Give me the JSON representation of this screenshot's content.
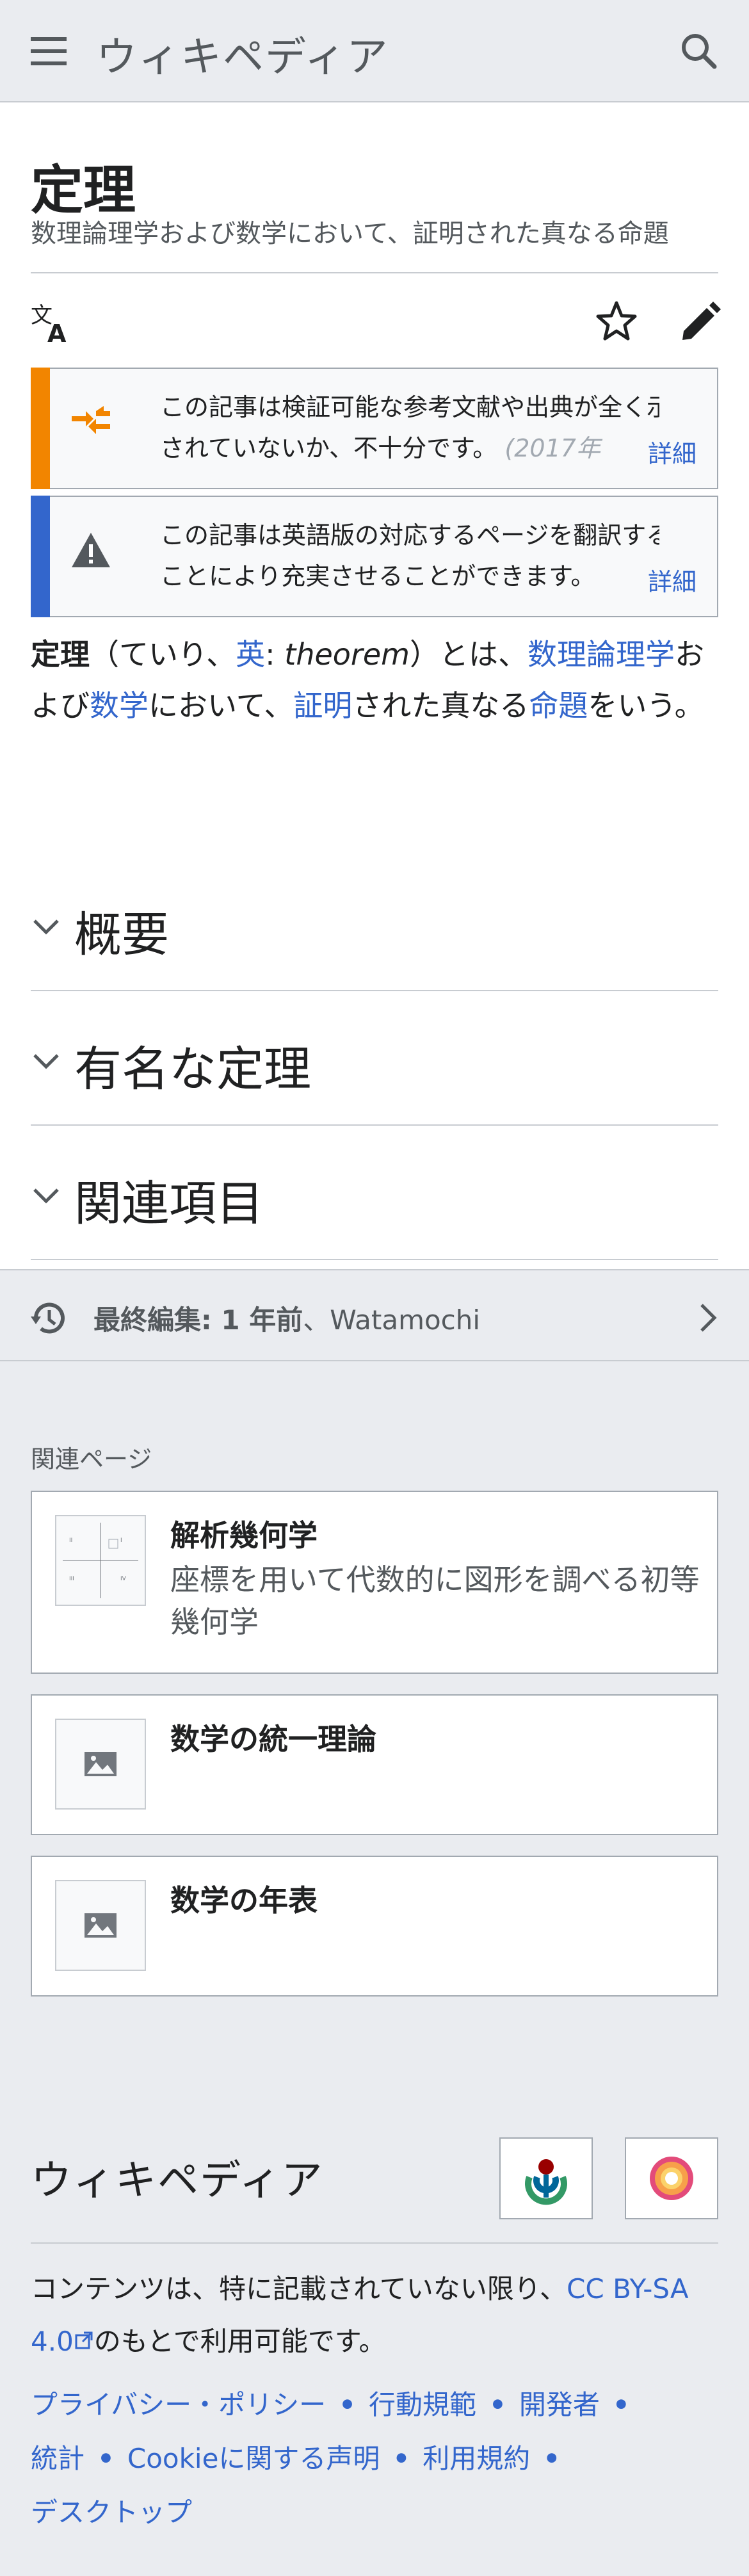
{
  "header": {
    "wordmark": "ウィキペディア"
  },
  "page": {
    "title": "定理",
    "tagline": "数理論理学および数学において、証明された真なる命題"
  },
  "notices": [
    {
      "text_line1": "この記事は検証可能な参考文献や出典が全く示",
      "text_line2": "されていないか、不十分です。",
      "text_fade": "(2017年",
      "detail": "詳細",
      "color": "#fc3"
    },
    {
      "text_line1": "この記事は英語版の対応するページを翻訳する",
      "text_line2": "ことにより充実させることができます。",
      "detail": "詳細",
      "color": "#36c"
    }
  ],
  "lead": {
    "term": "定理",
    "open": "（ていり、",
    "en": "英",
    "colon": ": ",
    "en_word": "theorem",
    "close": "）とは、",
    "link_math_logic": "数理論理学",
    "and": "および",
    "link_math": "数学",
    "in": "において、",
    "link_proof": "証明",
    "true": "された真なる",
    "link_prop": "命題",
    "end": "をいう。"
  },
  "sections": [
    "概要",
    "有名な定理",
    "関連項目"
  ],
  "last_edit": {
    "prefix": "最終編集: 1 年前",
    "sep": "、",
    "user": "Watamochi"
  },
  "related": {
    "title": "関連ページ",
    "cards": [
      {
        "title": "解析幾何学",
        "desc": "座標を用いて代数的に図形を調べる初等幾何学"
      },
      {
        "title": "数学の統一理論",
        "desc": ""
      },
      {
        "title": "数学の年表",
        "desc": ""
      }
    ]
  },
  "footer": {
    "wordmark": "ウィキペディア",
    "license_before": "コンテンツは、特に記載されていない限り、",
    "license_link": "CC BY-SA 4.0",
    "license_after": "のもとで利用可能です。",
    "links": [
      "プライバシー・ポリシー",
      "行動規範",
      "開発者",
      "統計",
      "Cookieに関する声明",
      "利用規約",
      "デスクトップ"
    ]
  },
  "colors": {
    "link": "#3366cc",
    "header_bg": "#eaecf0",
    "warning": "#fc3",
    "notice": "#36c"
  }
}
